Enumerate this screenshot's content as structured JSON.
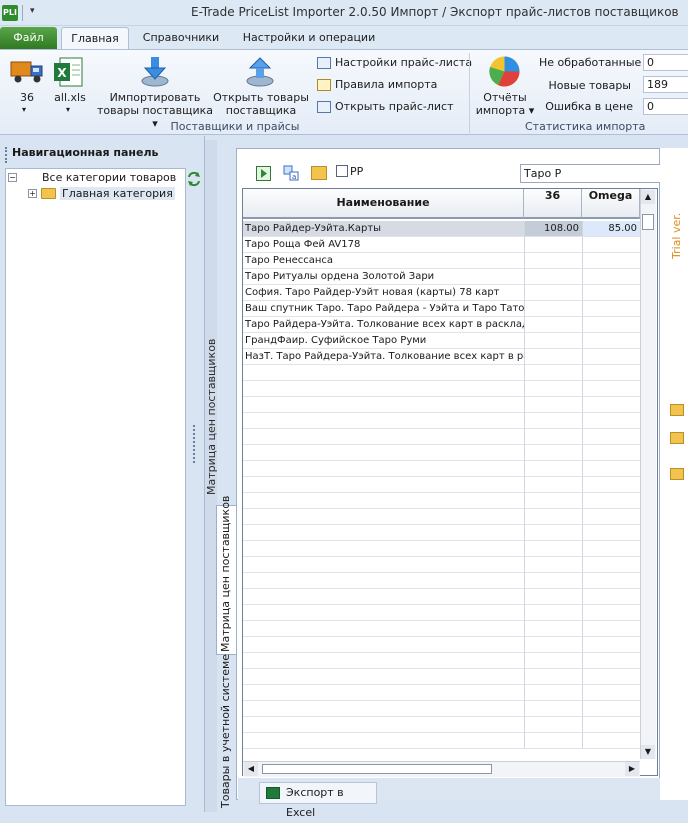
{
  "title_bar": {
    "logo_text": "PLI",
    "quick_access": "▾",
    "title": "E-Trade PriceList Importer 2.0.50     Импорт / Экспорт прайс-листов поставщиков"
  },
  "tabs": {
    "file": "Файл",
    "main": "Главная",
    "refs": "Справочники",
    "settings": "Настройки и операции"
  },
  "ribbon": {
    "supplier_label": "36",
    "file_label": "all.xls",
    "import_btn": [
      "Импортировать",
      "товары поставщика ▾"
    ],
    "open_btn": [
      "Открыть товары",
      "поставщика"
    ],
    "pricelist_settings": "Настройки прайс-листа",
    "import_rules": "Правила импорта",
    "open_pricelist": "Открыть прайс-лист",
    "group_suppliers": "Поставщики и прайсы",
    "reports_btn": [
      "Отчёты",
      "импорта ▾"
    ],
    "group_stats": "Статистика импорта",
    "stats": [
      {
        "label": "Не обработанные",
        "value": "0"
      },
      {
        "label": "Новые товары",
        "value": "189"
      },
      {
        "label": "Ошибка в цене",
        "value": "0"
      }
    ]
  },
  "nav": {
    "title": "Навигационная панель",
    "root": "Все категории товаров",
    "child": "Главная категория"
  },
  "vertical_tabs": {
    "matrix_top": "Матрица цен поставщиков",
    "matrix_active": "Матрица цен поставщиков",
    "accounting": "Товары в учетной системе"
  },
  "toolbar": {
    "checkbox_label": "PP",
    "search_value": "Таро Р"
  },
  "grid": {
    "col_name": "Наименование",
    "col_36": "36",
    "col_omega": "Omega",
    "rows": [
      {
        "name": "Таро Райдер-Уэйта.Карты",
        "p36": "108.00",
        "omega": "85.00"
      },
      {
        "name": "Таро Роща Фей AV178",
        "p36": "",
        "omega": ""
      },
      {
        "name": "Таро Ренессанса",
        "p36": "",
        "omega": ""
      },
      {
        "name": "Таро Ритуалы ордена Золотой Зари",
        "p36": "",
        "omega": ""
      },
      {
        "name": "София. Таро Райдер-Уэйт новая  (карты) 78 карт",
        "p36": "",
        "omega": ""
      },
      {
        "name": "Ваш спутник Таро. Таро Райдера - Уэйта и Таро Тато А",
        "p36": "",
        "omega": ""
      },
      {
        "name": "Таро Райдера-Уэйта. Толкование всех карт в раскладе",
        "p36": "",
        "omega": ""
      },
      {
        "name": "ГрандФаир. Суфийское Таро Руми",
        "p36": "",
        "omega": ""
      },
      {
        "name": "НазТ. Таро Райдера-Уэйта. Толкование всех карт в ра",
        "p36": "",
        "omega": ""
      }
    ]
  },
  "export_label": "Экспорт в Excel",
  "trial_text": "Trial ver."
}
